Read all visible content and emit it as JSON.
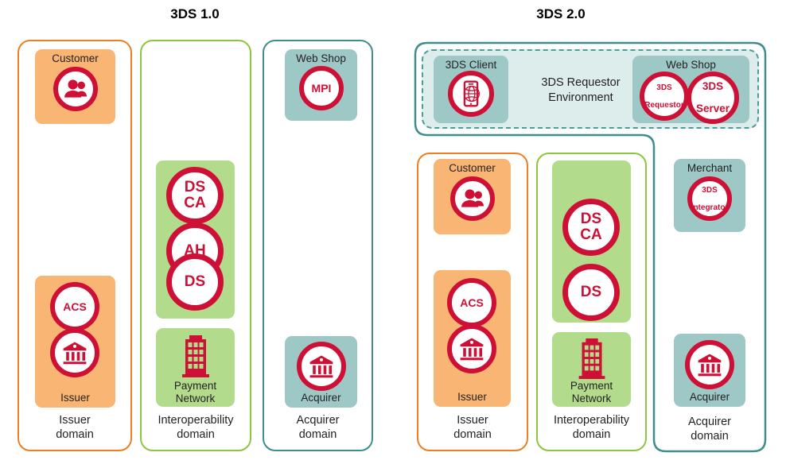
{
  "headings": {
    "left": "3DS 1.0",
    "right": "3DS 2.0"
  },
  "colors": {
    "orange_border": "#EE7E22",
    "green_border": "#8CC63E",
    "teal_border": "#3D8E8D",
    "orange_card": "#F8B573",
    "green_card": "#B3DB8C",
    "teal_card": "#9DC8C6",
    "env_bg": "#DDEDEB",
    "env_dash": "#4E9B9A",
    "badge_red": "#CE1036",
    "text": "#231F20"
  },
  "v1": {
    "domains": [
      {
        "id": "issuer",
        "label_line1": "Issuer",
        "label_line2": "domain",
        "color": "orange"
      },
      {
        "id": "interoperability",
        "label_line1": "Interoperability",
        "label_line2": "domain",
        "color": "green"
      },
      {
        "id": "acquirer",
        "label_line1": "Acquirer",
        "label_line2": "domain",
        "color": "teal"
      }
    ],
    "cards": {
      "customer": {
        "title": "Customer",
        "icon": "people-icon"
      },
      "issuer": {
        "footer": "Issuer",
        "badges": [
          "ACS"
        ],
        "icon": "bank-icon"
      },
      "ds_group": {
        "badges": [
          "DS CA",
          "AH",
          "DS"
        ]
      },
      "payment_network": {
        "footer_line1": "Payment",
        "footer_line2": "Network",
        "icon": "building-icon"
      },
      "web_shop": {
        "title": "Web Shop",
        "badge": "MPI"
      },
      "acquirer": {
        "footer": "Acquirer",
        "icon": "bank-icon"
      }
    }
  },
  "v2": {
    "requestor_env": {
      "label_line1": "3DS Requestor",
      "label_line2": "Environment"
    },
    "cards": {
      "threeds_client": {
        "title": "3DS Client",
        "icon": "mobile-globe-icon"
      },
      "web_shop": {
        "title": "Web Shop",
        "badge_left_line1": "3DS",
        "badge_left_line2": "Requestor",
        "badge_right_line1": "3DS",
        "badge_right_line2": "Server"
      },
      "customer": {
        "title": "Customer",
        "icon": "people-icon"
      },
      "issuer": {
        "footer": "Issuer",
        "badges": [
          "ACS"
        ],
        "icon": "bank-icon"
      },
      "ds_group": {
        "badges": [
          "DS CA",
          "DS"
        ]
      },
      "payment_network": {
        "footer_line1": "Payment",
        "footer_line2": "Network",
        "icon": "building-icon"
      },
      "merchant": {
        "title": "Merchant",
        "badge_line1": "3DS",
        "badge_line2": "Integrator"
      },
      "acquirer": {
        "footer": "Acquirer",
        "icon": "bank-icon"
      }
    },
    "domains": [
      {
        "id": "issuer",
        "label_line1": "Issuer",
        "label_line2": "domain",
        "color": "orange"
      },
      {
        "id": "interoperability",
        "label_line1": "Interoperability",
        "label_line2": "domain",
        "color": "green"
      },
      {
        "id": "acquirer",
        "label_line1": "Acquirer",
        "label_line2": "domain",
        "color": "teal"
      }
    ]
  }
}
